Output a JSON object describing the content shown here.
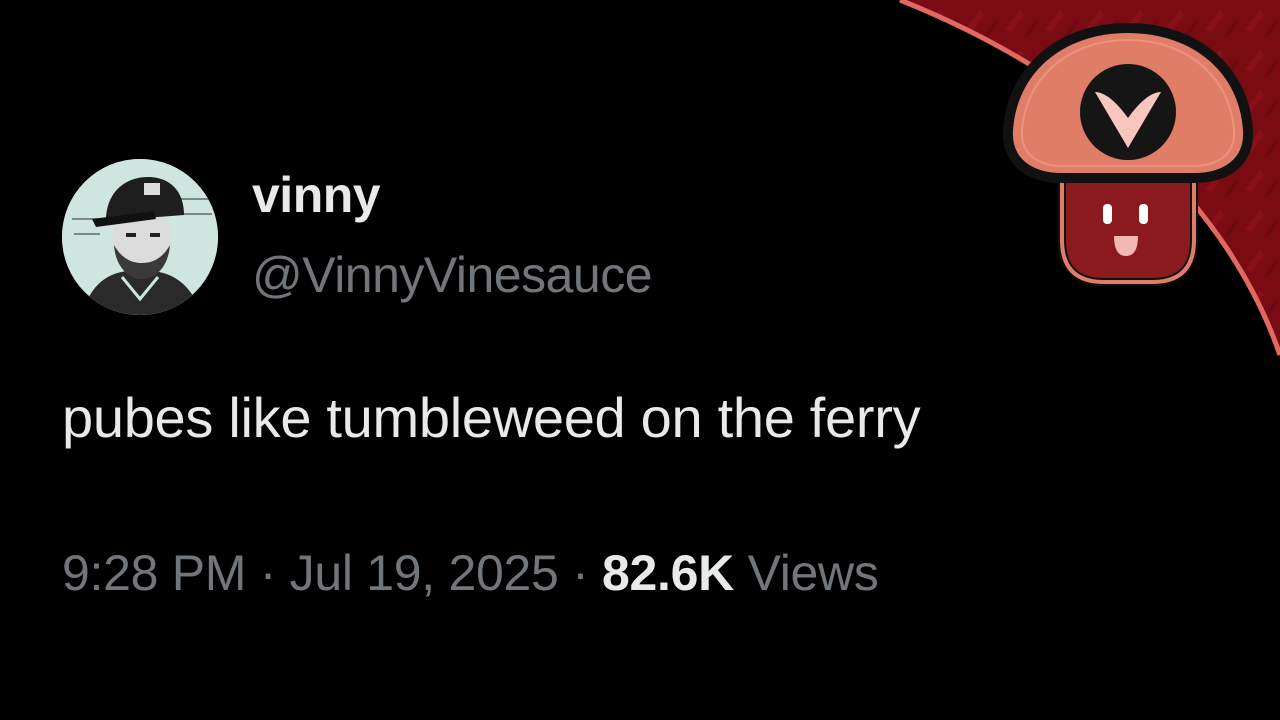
{
  "tweet": {
    "display_name": "vinny",
    "handle": "@VinnyVinesauce",
    "text": "pubes like tumbleweed on the ferry",
    "time": "9:28 PM",
    "separator": "·",
    "date": "Jul 19, 2025",
    "views_count": "82.6K",
    "views_label": "Views"
  },
  "colors": {
    "background": "#000000",
    "primary_text": "#e7e9ea",
    "secondary_text": "#71767b",
    "corner_red": "#7a0b12",
    "corner_border": "#e06a62",
    "logo_cap": "#e07d67",
    "logo_stem": "#8b1a1f"
  },
  "icons": {
    "avatar": "user-avatar",
    "logo": "vinesauce-mushroom-logo"
  }
}
